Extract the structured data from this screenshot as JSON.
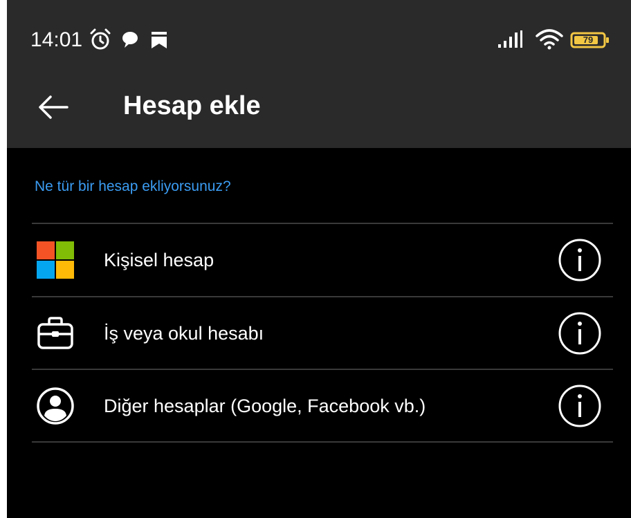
{
  "status_bar": {
    "time": "14:01",
    "icons": [
      "alarm-icon",
      "chat-bubble-icon",
      "bookmark-icon",
      "signal-icon",
      "wifi-icon",
      "battery-icon"
    ],
    "battery_level": "79"
  },
  "header": {
    "back_icon": "arrow-left-icon",
    "title": "Hesap ekle"
  },
  "main": {
    "prompt": "Ne tür bir hesap ekliyorsunuz?",
    "accounts": [
      {
        "label": "Kişisel hesap",
        "icon": "microsoft-logo-icon",
        "info_icon": "info-icon"
      },
      {
        "label": "İş veya okul hesabı",
        "icon": "briefcase-icon",
        "info_icon": "info-icon"
      },
      {
        "label": "Diğer hesaplar (Google, Facebook vb.)",
        "icon": "user-circle-icon",
        "info_icon": "info-icon"
      }
    ]
  },
  "colors": {
    "header_bg": "#2a2a2a",
    "page_bg": "#000000",
    "accent": "#3b9cf2",
    "ms_red": "#f35325",
    "ms_green": "#81bc06",
    "ms_blue": "#05a6f0",
    "ms_yellow": "#ffba08",
    "battery": "#f2c744"
  }
}
